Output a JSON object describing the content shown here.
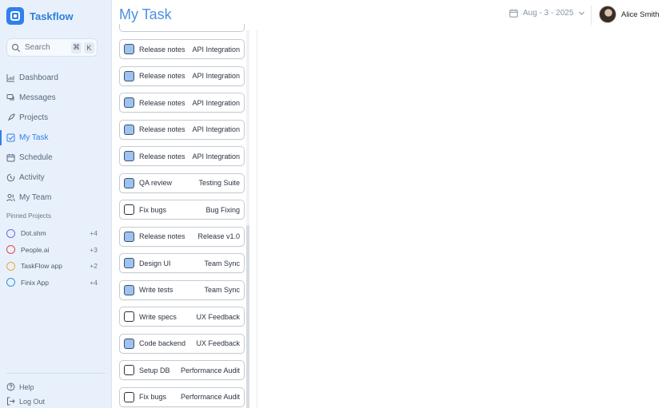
{
  "brand": {
    "name": "Taskflow"
  },
  "search": {
    "label": "Search",
    "key1": "⌘",
    "key2": "K"
  },
  "nav": {
    "items": [
      {
        "label": "Dashboard",
        "icon": "chart-icon"
      },
      {
        "label": "Messages",
        "icon": "messages-icon"
      },
      {
        "label": "Projects",
        "icon": "rocket-icon"
      },
      {
        "label": "My Task",
        "icon": "task-check-icon",
        "active": true
      },
      {
        "label": "Schedule",
        "icon": "calendar-icon"
      },
      {
        "label": "Activity",
        "icon": "activity-icon"
      },
      {
        "label": "My Team",
        "icon": "team-icon"
      }
    ]
  },
  "pinned": {
    "title": "Pinned Projects",
    "items": [
      {
        "name": "Dot.shm",
        "count": "+4",
        "color": "#6a6fd8"
      },
      {
        "name": "People.ai",
        "count": "+3",
        "color": "#e5484d"
      },
      {
        "name": "TaskFlow app",
        "count": "+2",
        "color": "#f0a63a"
      },
      {
        "name": "Finix App",
        "count": "+4",
        "color": "#3b8fd9"
      }
    ]
  },
  "footer": {
    "help": "Help",
    "logout": "Log Out"
  },
  "header": {
    "title": "My Task",
    "date_range": "Aug - 3 - 2025",
    "user_name": "Alice Smith"
  },
  "tasks": [
    {
      "title": "Release notes",
      "project": "API Integration",
      "checked": true
    },
    {
      "title": "Release notes",
      "project": "API Integration",
      "checked": true
    },
    {
      "title": "Release notes",
      "project": "API Integration",
      "checked": true
    },
    {
      "title": "Release notes",
      "project": "API Integration",
      "checked": true
    },
    {
      "title": "Release notes",
      "project": "API Integration",
      "checked": true
    },
    {
      "title": "QA review",
      "project": "Testing Suite",
      "checked": true
    },
    {
      "title": "Fix bugs",
      "project": "Bug Fixing",
      "checked": false
    },
    {
      "title": "Release notes",
      "project": "Release v1.0",
      "checked": true
    },
    {
      "title": "Design UI",
      "project": "Team Sync",
      "checked": true
    },
    {
      "title": "Write tests",
      "project": "Team Sync",
      "checked": true
    },
    {
      "title": "Write specs",
      "project": "UX Feedback",
      "checked": false
    },
    {
      "title": "Code backend",
      "project": "UX Feedback",
      "checked": true
    },
    {
      "title": "Setup DB",
      "project": "Performance Audit",
      "checked": false
    },
    {
      "title": "Fix bugs",
      "project": "Performance Audit",
      "checked": false
    }
  ]
}
